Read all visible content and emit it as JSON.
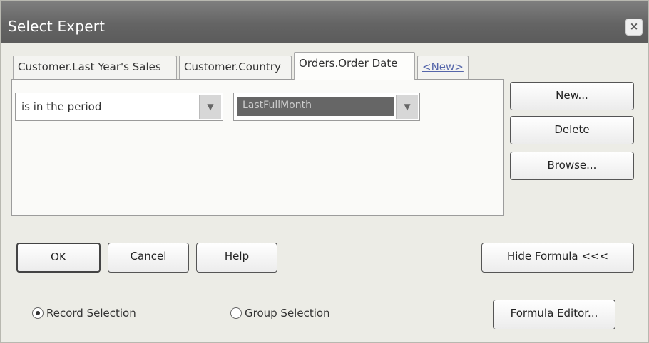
{
  "window": {
    "title": "Select Expert",
    "close_glyph": "×"
  },
  "tabs": [
    {
      "label": "Customer.Last Year's Sales"
    },
    {
      "label": "Customer.Country"
    },
    {
      "label": "Orders.Order Date",
      "active": true
    },
    {
      "label": "<New>"
    }
  ],
  "condition": {
    "operator": "is in the period",
    "period_selected": "LastFullMonth"
  },
  "side_buttons": {
    "new": "New...",
    "delete": "Delete",
    "browse": "Browse..."
  },
  "bottom_buttons": {
    "ok": "OK",
    "cancel": "Cancel",
    "help": "Help",
    "hide_formula": "Hide Formula <<<"
  },
  "selection_type": {
    "record": "Record Selection",
    "group": "Group Selection",
    "selected": "record"
  },
  "formula_editor_button": "Formula Editor...",
  "colors": {
    "titlebar": "#646464",
    "dialog_bg": "#ecece6",
    "highlight": "#666666"
  },
  "icons": {
    "dropdown": "chevron-down-icon",
    "close": "close-icon"
  }
}
